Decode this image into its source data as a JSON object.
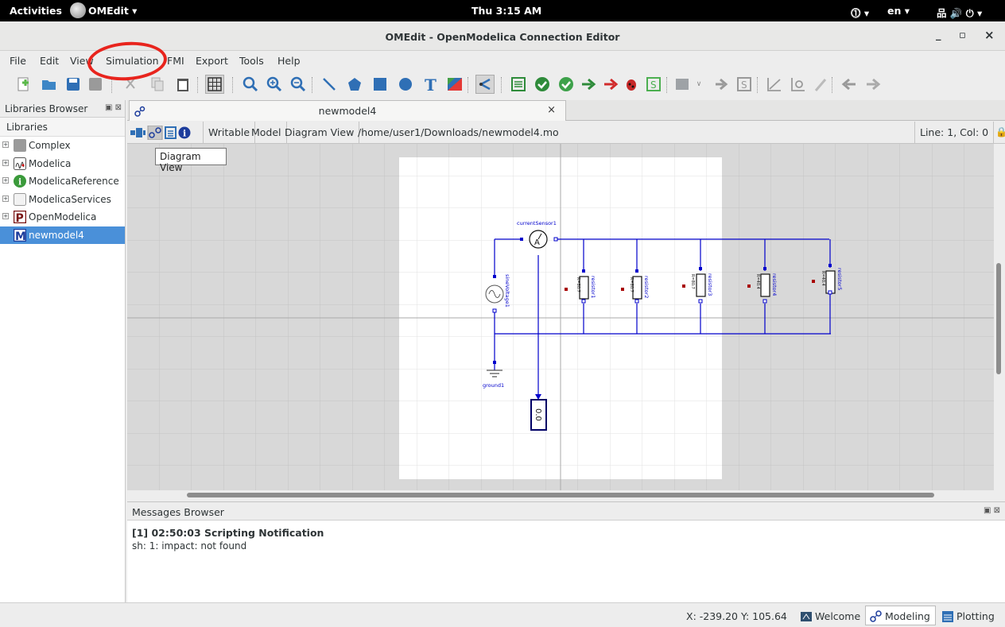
{
  "topbar": {
    "activities": "Activities",
    "app_menu": "OMEdit ▾",
    "clock": "Thu 3:15 AM",
    "accessibility": "⓵ ▾",
    "language": "en ▾",
    "system": "品 🔊 ⏻ ▾"
  },
  "window": {
    "title": "OMEdit - OpenModelica Connection Editor",
    "minimize": "_",
    "maximize": "▫",
    "close": "×"
  },
  "menubar": {
    "items": [
      "File",
      "Edit",
      "View",
      "Simulation",
      "FMI",
      "Export",
      "Tools",
      "Help"
    ]
  },
  "libraries_browser": {
    "title": "Libraries Browser",
    "header": "Libraries",
    "items": [
      {
        "label": "Complex",
        "icon": "complex-icon"
      },
      {
        "label": "Modelica",
        "icon": "modelica-icon"
      },
      {
        "label": "ModelicaReference",
        "icon": "info-icon"
      },
      {
        "label": "ModelicaServices",
        "icon": "package-icon"
      },
      {
        "label": "OpenModelica",
        "icon": "openmodelica-icon"
      },
      {
        "label": "newmodel4",
        "icon": "model-icon"
      }
    ]
  },
  "tab": {
    "label": "newmodel4",
    "close": "×"
  },
  "infobar": {
    "writable": "Writable",
    "model": "Model",
    "view": "Diagram View",
    "path": "/home/user1/Downloads/newmodel4.mo",
    "line_col": "Line: 1, Col: 0"
  },
  "tooltip": "Diagram View",
  "diagram": {
    "current_sensor": "currentSensor1",
    "sine_voltage": "sineVoltage1",
    "ground": "ground1",
    "display": "0.0",
    "resistors": [
      {
        "name": "resistor1",
        "param": "R=80.7"
      },
      {
        "name": "resistor2",
        "param": "R=80.7"
      },
      {
        "name": "resistor3",
        "param": "R=80.7"
      },
      {
        "name": "resistor4",
        "param": "R=40.4"
      },
      {
        "name": "resistor5",
        "param": "R=40.4"
      }
    ]
  },
  "messages": {
    "title": "Messages Browser",
    "entry_header": "[1] 02:50:03 Scripting Notification",
    "entry_body": "sh: 1: impact: not found"
  },
  "statusbar": {
    "coords": "X: -239.20 Y: 105.64",
    "welcome": "Welcome",
    "modeling": "Modeling",
    "plotting": "Plotting"
  },
  "colors": {
    "accent": "#4a90d9",
    "wire": "#0000cc",
    "annotation": "#e8241d"
  }
}
